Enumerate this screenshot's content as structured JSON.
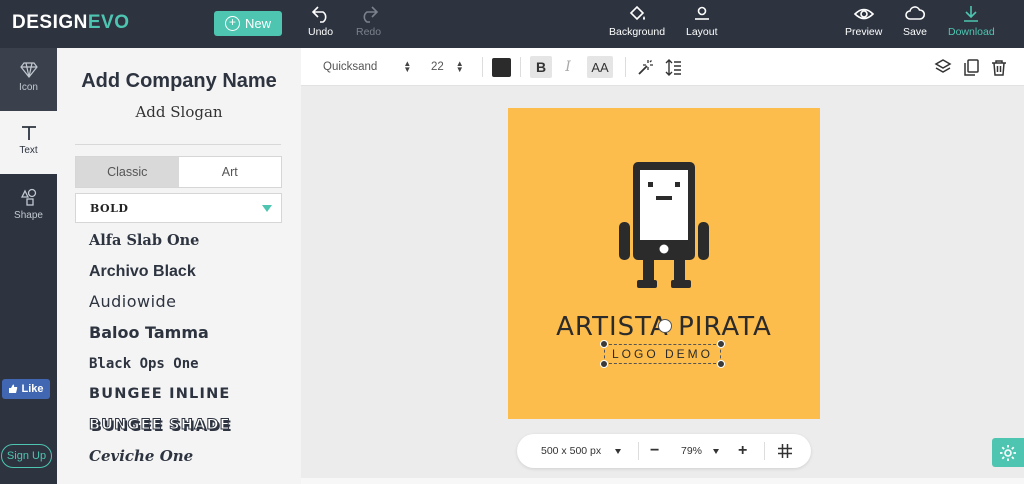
{
  "header": {
    "logo_part1": "DESIGN",
    "logo_part2": "EVO",
    "new_label": "New",
    "undo_label": "Undo",
    "redo_label": "Redo",
    "background_label": "Background",
    "layout_label": "Layout",
    "preview_label": "Preview",
    "save_label": "Save",
    "download_label": "Download"
  },
  "rail": {
    "icon_label": "Icon",
    "text_label": "Text",
    "shape_label": "Shape",
    "like_label": "Like",
    "signup_label": "Sign Up"
  },
  "panel": {
    "company_name": "Add Company Name",
    "slogan": "Add Slogan",
    "tab_classic": "Classic",
    "tab_art": "Art",
    "font_category": "BOLD",
    "fonts": [
      "Alfa Slab One",
      "Archivo Black",
      "Audiowide",
      "Baloo Tamma",
      "Black Ops One",
      "BUNGEE INLINE",
      "BUNGEE SHADE",
      "Ceviche One"
    ]
  },
  "toolbar": {
    "font_family": "Quicksand",
    "font_size": "22",
    "text_color": "#2b2b2b",
    "bold_label": "B",
    "italic_label": "I",
    "case_label": "AA"
  },
  "canvas": {
    "background_color": "#fdbd4c",
    "brand_name": "ARTISTA PIRATA",
    "tagline": "LOGO DEMO"
  },
  "zoom": {
    "size_label": "500 x 500 px",
    "zoom_level": "79%",
    "minus_label": "−",
    "plus_label": "+"
  },
  "colors": {
    "accent": "#4ec5b1",
    "dark": "#2d3440"
  }
}
